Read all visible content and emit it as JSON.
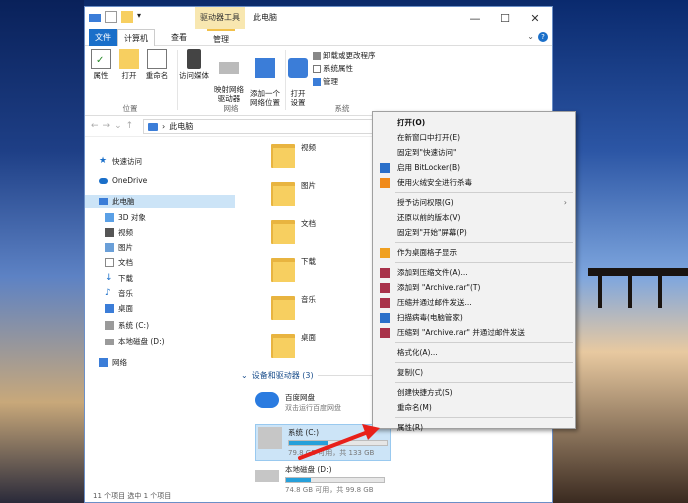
{
  "window": {
    "context_tool_label": "驱动器工具",
    "title": "此电脑",
    "min": "—",
    "max": "☐",
    "close": "✕"
  },
  "tabs": {
    "file": "文件",
    "computer": "计算机",
    "view": "查看",
    "manage": "管理"
  },
  "ribbon": {
    "groups": {
      "location": "位置",
      "network": "网络",
      "system": "系统"
    },
    "properties": "属性",
    "open": "打开",
    "rename": "重命名",
    "media_access": "访问媒体",
    "map_network_drive": "映射网络\n驱动器",
    "add_network_location": "添加一个\n网络位置",
    "open_settings": "打开\n设置",
    "uninstall": "卸载或更改程序",
    "sys_props": "系统属性",
    "manage": "管理"
  },
  "address": {
    "path": "此电脑"
  },
  "sidebar": {
    "items": [
      {
        "label": "快速访问"
      },
      {
        "label": "OneDrive"
      },
      {
        "label": "此电脑"
      },
      {
        "label": "3D 对象"
      },
      {
        "label": "视频"
      },
      {
        "label": "图片"
      },
      {
        "label": "文档"
      },
      {
        "label": "下载"
      },
      {
        "label": "音乐"
      },
      {
        "label": "桌面"
      },
      {
        "label": "系统 (C:)"
      },
      {
        "label": "本地磁盘 (D:)"
      },
      {
        "label": "网络"
      }
    ]
  },
  "folders": [
    "视频",
    "图片",
    "文档",
    "下载",
    "音乐",
    "桌面"
  ],
  "section": {
    "devices": "设备和驱动器 (3)"
  },
  "drives": [
    {
      "name": "百度网盘",
      "sub": "双击运行百度网盘",
      "fill": null
    },
    {
      "name": "系统 (C:)",
      "sub": "79.8 GB 可用，共 133 GB",
      "fill": 0.4
    },
    {
      "name": "本地磁盘 (D:)",
      "sub": "74.8 GB 可用，共 99.8 GB",
      "fill": 0.25
    }
  ],
  "status": "11 个项目    选中 1 个项目",
  "context_menu": {
    "items": [
      {
        "label": "打开(O)",
        "bold": true
      },
      {
        "label": "在新窗口中打开(E)"
      },
      {
        "label": "固定到\"快速访问\""
      },
      {
        "label": "启用 BitLocker(B)",
        "icon": "shield-icon"
      },
      {
        "label": "使用火绒安全进行杀毒",
        "icon": "huorong-icon"
      },
      {
        "sep": true
      },
      {
        "label": "授予访问权限(G)",
        "submenu": true
      },
      {
        "label": "还原以前的版本(V)"
      },
      {
        "label": "固定到\"开始\"屏幕(P)"
      },
      {
        "sep": true
      },
      {
        "label": "作为桌面格子显示",
        "icon": "grid-icon"
      },
      {
        "sep": true
      },
      {
        "label": "添加到压缩文件(A)...",
        "icon": "winrar-icon"
      },
      {
        "label": "添加到 \"Archive.rar\"(T)",
        "icon": "winrar-icon"
      },
      {
        "label": "压缩并通过邮件发送...",
        "icon": "winrar-icon"
      },
      {
        "label": "扫描病毒(电脑管家)",
        "icon": "guard-icon"
      },
      {
        "label": "压缩到 \"Archive.rar\" 并通过邮件发送",
        "icon": "winrar-icon"
      },
      {
        "sep": true
      },
      {
        "label": "格式化(A)..."
      },
      {
        "sep": true
      },
      {
        "label": "复制(C)"
      },
      {
        "sep": true
      },
      {
        "label": "创建快捷方式(S)"
      },
      {
        "label": "重命名(M)"
      },
      {
        "sep": true
      },
      {
        "label": "属性(R)"
      }
    ]
  },
  "colors": {
    "accent": "#1a6fc9",
    "selection": "#cce4f7",
    "arrow": "#e8201a"
  }
}
